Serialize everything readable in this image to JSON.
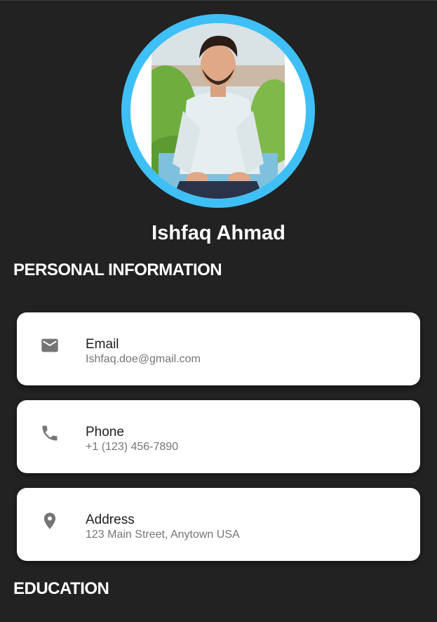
{
  "profile": {
    "name": "Ishfaq Ahmad",
    "avatar_alt": "profile photo"
  },
  "sections": {
    "personal": "PERSONAL INFORMATION",
    "education": "EDUCATION"
  },
  "contacts": [
    {
      "icon": "email-icon",
      "label": "Email",
      "value": "Ishfaq.doe@gmail.com"
    },
    {
      "icon": "phone-icon",
      "label": "Phone",
      "value": "+1 (123) 456-7890"
    },
    {
      "icon": "location-pin-icon",
      "label": "Address",
      "value": "123 Main Street, Anytown USA"
    }
  ],
  "colors": {
    "background": "#222222",
    "accent_ring": "#3ec0f6",
    "card": "#ffffff",
    "icon": "#757575"
  }
}
